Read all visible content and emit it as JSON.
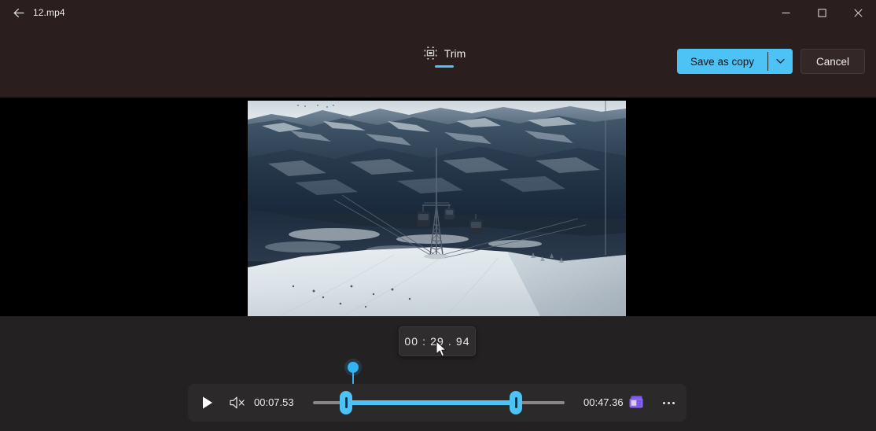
{
  "window": {
    "title": "12.mp4",
    "back_icon": "back-arrow-icon",
    "controls": {
      "minimize": "minimize-icon",
      "maximize": "maximize-icon",
      "close": "close-icon"
    }
  },
  "commandbar": {
    "tabs": [
      {
        "label": "Trim",
        "icon": "trim-icon",
        "active": true
      }
    ],
    "save_as_copy_label": "Save as copy",
    "save_dropdown_icon": "chevron-down-icon",
    "cancel_label": "Cancel",
    "accent_color": "#4cc2f5"
  },
  "tooltip": {
    "timecode": "00 : 29 . 94"
  },
  "player": {
    "play_icon": "play-icon",
    "mute_icon": "speaker-mute-icon",
    "current_time": "00:07.53",
    "total_time": "00:47.36",
    "clip_icon": "video-clip-icon",
    "more_icon": "more-options-icon",
    "trim_start_handle": "trim-start-handle",
    "trim_end_handle": "trim-end-handle",
    "playhead": "playhead-marker",
    "track_color": "#4cc2f5",
    "rail_color": "#8a8787"
  },
  "video": {
    "description": "snowy mountain valley with gondola cable car and ski slope"
  },
  "theme": {
    "titlebar_bg": "#2a1e1e",
    "panel_bg": "#232121",
    "stage_bg": "#000000",
    "text_color": "#f0ecec"
  }
}
